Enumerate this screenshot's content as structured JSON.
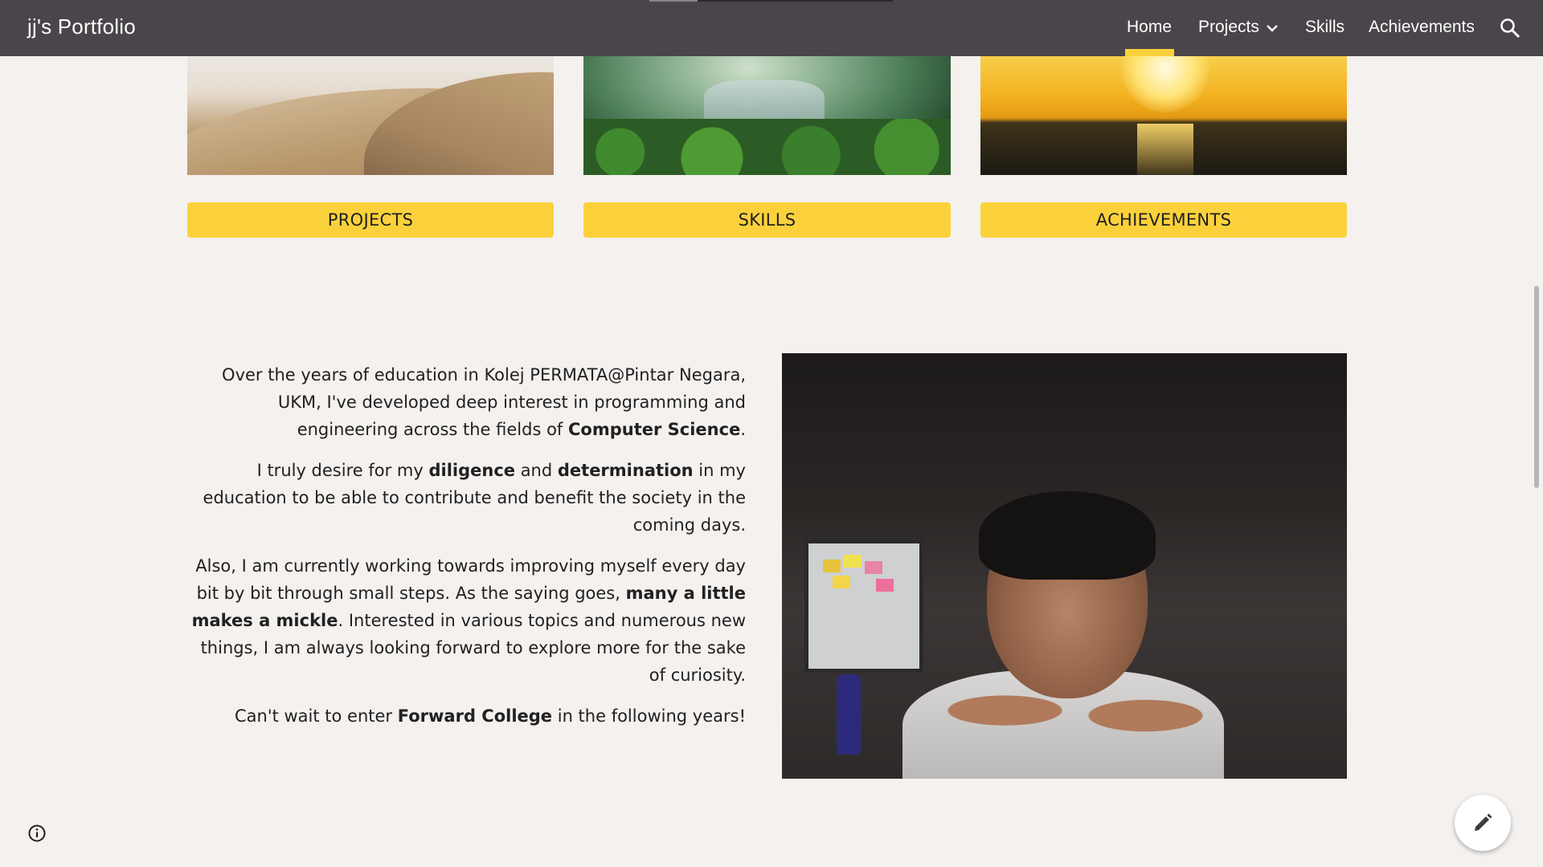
{
  "header": {
    "site_title": "jj's Portfolio",
    "nav": [
      {
        "label": "Home",
        "active": true
      },
      {
        "label": "Projects",
        "has_dropdown": true
      },
      {
        "label": "Skills"
      },
      {
        "label": "Achievements"
      }
    ],
    "search_icon": "search-icon",
    "accent_color": "#fbd13b",
    "bar_color": "#4a454a"
  },
  "cards": [
    {
      "image": "desert dunes",
      "button_label": "PROJECTS"
    },
    {
      "image": "jungle waterfall",
      "button_label": "SKILLS"
    },
    {
      "image": "sunset over sea",
      "button_label": "ACHIEVEMENTS"
    }
  ],
  "about": {
    "p1_a": "Over the years of education in Kolej PERMATA@Pintar Negara, UKM, I've developed deep interest in programming and engineering across the fields of ",
    "p1_b": "Computer Science",
    "p1_c": ".",
    "p2_a": "I truly desire for my ",
    "p2_b": "diligence",
    "p2_c": " and ",
    "p2_d": "determination",
    "p2_e": " in my education to be able to contribute and benefit the society in the coming days.",
    "p3_a": "Also, I am currently working towards improving myself every day bit by bit through small steps. As the saying goes, ",
    "p3_b": "many a little makes a mickle",
    "p3_c": ". Interested in various topics and numerous new things, I am always looking forward to explore more for the sake of curiosity.",
    "p4_a": "Can't wait to enter ",
    "p4_b": "Forward College",
    "p4_c": " in the following years!"
  },
  "controls": {
    "info_icon": "info-icon",
    "edit_icon": "pencil-icon"
  }
}
